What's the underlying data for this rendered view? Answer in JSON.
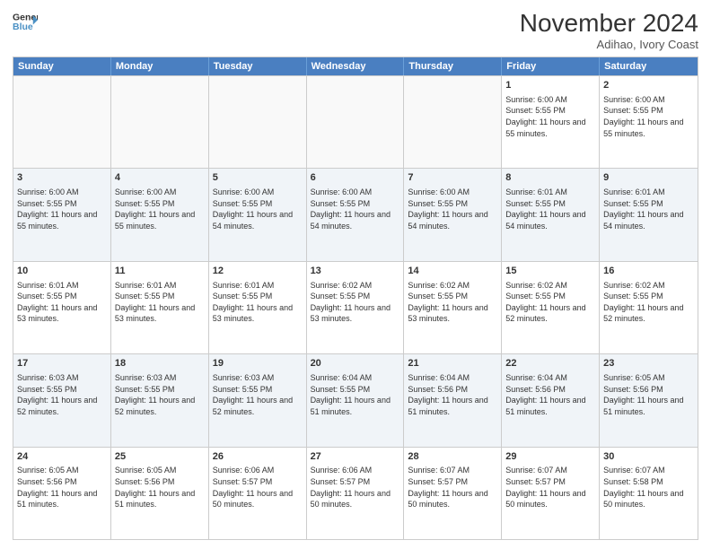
{
  "header": {
    "logo_line1": "General",
    "logo_line2": "Blue",
    "month_title": "November 2024",
    "location": "Adihao, Ivory Coast"
  },
  "days_of_week": [
    "Sunday",
    "Monday",
    "Tuesday",
    "Wednesday",
    "Thursday",
    "Friday",
    "Saturday"
  ],
  "weeks": [
    [
      {
        "day": "",
        "info": ""
      },
      {
        "day": "",
        "info": ""
      },
      {
        "day": "",
        "info": ""
      },
      {
        "day": "",
        "info": ""
      },
      {
        "day": "",
        "info": ""
      },
      {
        "day": "1",
        "info": "Sunrise: 6:00 AM\nSunset: 5:55 PM\nDaylight: 11 hours and 55 minutes."
      },
      {
        "day": "2",
        "info": "Sunrise: 6:00 AM\nSunset: 5:55 PM\nDaylight: 11 hours and 55 minutes."
      }
    ],
    [
      {
        "day": "3",
        "info": "Sunrise: 6:00 AM\nSunset: 5:55 PM\nDaylight: 11 hours and 55 minutes."
      },
      {
        "day": "4",
        "info": "Sunrise: 6:00 AM\nSunset: 5:55 PM\nDaylight: 11 hours and 55 minutes."
      },
      {
        "day": "5",
        "info": "Sunrise: 6:00 AM\nSunset: 5:55 PM\nDaylight: 11 hours and 54 minutes."
      },
      {
        "day": "6",
        "info": "Sunrise: 6:00 AM\nSunset: 5:55 PM\nDaylight: 11 hours and 54 minutes."
      },
      {
        "day": "7",
        "info": "Sunrise: 6:00 AM\nSunset: 5:55 PM\nDaylight: 11 hours and 54 minutes."
      },
      {
        "day": "8",
        "info": "Sunrise: 6:01 AM\nSunset: 5:55 PM\nDaylight: 11 hours and 54 minutes."
      },
      {
        "day": "9",
        "info": "Sunrise: 6:01 AM\nSunset: 5:55 PM\nDaylight: 11 hours and 54 minutes."
      }
    ],
    [
      {
        "day": "10",
        "info": "Sunrise: 6:01 AM\nSunset: 5:55 PM\nDaylight: 11 hours and 53 minutes."
      },
      {
        "day": "11",
        "info": "Sunrise: 6:01 AM\nSunset: 5:55 PM\nDaylight: 11 hours and 53 minutes."
      },
      {
        "day": "12",
        "info": "Sunrise: 6:01 AM\nSunset: 5:55 PM\nDaylight: 11 hours and 53 minutes."
      },
      {
        "day": "13",
        "info": "Sunrise: 6:02 AM\nSunset: 5:55 PM\nDaylight: 11 hours and 53 minutes."
      },
      {
        "day": "14",
        "info": "Sunrise: 6:02 AM\nSunset: 5:55 PM\nDaylight: 11 hours and 53 minutes."
      },
      {
        "day": "15",
        "info": "Sunrise: 6:02 AM\nSunset: 5:55 PM\nDaylight: 11 hours and 52 minutes."
      },
      {
        "day": "16",
        "info": "Sunrise: 6:02 AM\nSunset: 5:55 PM\nDaylight: 11 hours and 52 minutes."
      }
    ],
    [
      {
        "day": "17",
        "info": "Sunrise: 6:03 AM\nSunset: 5:55 PM\nDaylight: 11 hours and 52 minutes."
      },
      {
        "day": "18",
        "info": "Sunrise: 6:03 AM\nSunset: 5:55 PM\nDaylight: 11 hours and 52 minutes."
      },
      {
        "day": "19",
        "info": "Sunrise: 6:03 AM\nSunset: 5:55 PM\nDaylight: 11 hours and 52 minutes."
      },
      {
        "day": "20",
        "info": "Sunrise: 6:04 AM\nSunset: 5:55 PM\nDaylight: 11 hours and 51 minutes."
      },
      {
        "day": "21",
        "info": "Sunrise: 6:04 AM\nSunset: 5:56 PM\nDaylight: 11 hours and 51 minutes."
      },
      {
        "day": "22",
        "info": "Sunrise: 6:04 AM\nSunset: 5:56 PM\nDaylight: 11 hours and 51 minutes."
      },
      {
        "day": "23",
        "info": "Sunrise: 6:05 AM\nSunset: 5:56 PM\nDaylight: 11 hours and 51 minutes."
      }
    ],
    [
      {
        "day": "24",
        "info": "Sunrise: 6:05 AM\nSunset: 5:56 PM\nDaylight: 11 hours and 51 minutes."
      },
      {
        "day": "25",
        "info": "Sunrise: 6:05 AM\nSunset: 5:56 PM\nDaylight: 11 hours and 51 minutes."
      },
      {
        "day": "26",
        "info": "Sunrise: 6:06 AM\nSunset: 5:57 PM\nDaylight: 11 hours and 50 minutes."
      },
      {
        "day": "27",
        "info": "Sunrise: 6:06 AM\nSunset: 5:57 PM\nDaylight: 11 hours and 50 minutes."
      },
      {
        "day": "28",
        "info": "Sunrise: 6:07 AM\nSunset: 5:57 PM\nDaylight: 11 hours and 50 minutes."
      },
      {
        "day": "29",
        "info": "Sunrise: 6:07 AM\nSunset: 5:57 PM\nDaylight: 11 hours and 50 minutes."
      },
      {
        "day": "30",
        "info": "Sunrise: 6:07 AM\nSunset: 5:58 PM\nDaylight: 11 hours and 50 minutes."
      }
    ]
  ]
}
